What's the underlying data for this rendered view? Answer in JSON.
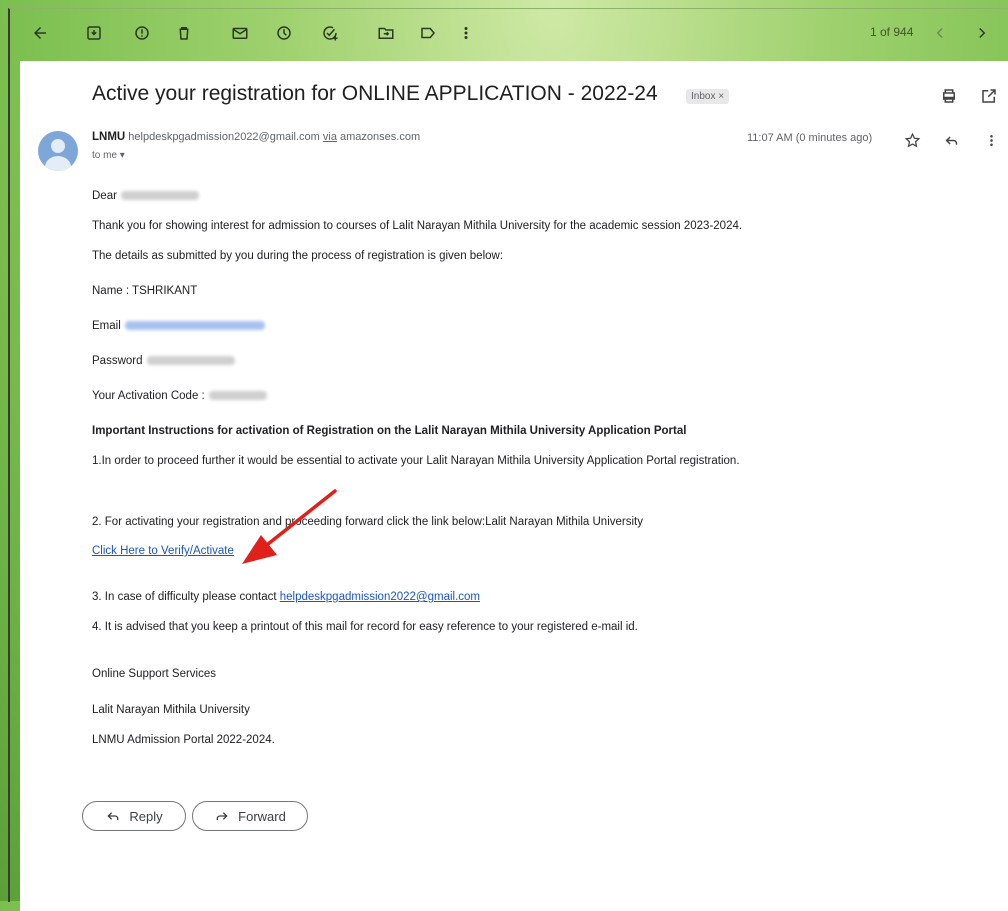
{
  "toolbar": {
    "counter": "1 of 944"
  },
  "email": {
    "subject": "Active your registration for ONLINE APPLICATION - 2022-24",
    "label_chip": "Inbox ×",
    "sender_name": "LNMU",
    "sender_email": "helpdeskpgadmission2022@gmail.com",
    "via_word": "via",
    "via_domain": "amazonses.com",
    "to_line": "to me ▾",
    "time": "11:07 AM (0 minutes ago)",
    "greeting": "Dear",
    "line_thanks": "Thank you for showing interest for admission to courses of Lalit Narayan Mithila University for the academic session 2023-2024.",
    "line_details": "The details as submitted by you during the process of registration is given below:",
    "name_line": "Name : TSHRIKANT",
    "email_label": "Email",
    "password_label": "Password",
    "activation_label": "Your Activation Code :",
    "instructions_heading": "Important Instructions for activation of Registration on the Lalit Narayan Mithila University Application Portal",
    "step1": "1.In order to proceed further it would be essential to activate your Lalit Narayan Mithila University Application Portal registration.",
    "step2": "2. For activating your registration and proceeding forward click the link below:Lalit Narayan Mithila University",
    "verify_link": "Click Here to Verify/Activate",
    "step3_prefix": "3. In case of difficulty please contact",
    "step3_email": "helpdeskpgadmission2022@gmail.com",
    "step4": "4. It is advised that you keep a printout of this mail for record for easy reference to your registered e-mail id.",
    "sig1": "Online Support Services",
    "sig2": "Lalit Narayan Mithila University",
    "sig3": "LNMU Admission Portal 2022-2024."
  },
  "actions": {
    "reply_label": "Reply",
    "forward_label": "Forward"
  },
  "colors": {
    "link": "#1a55c4",
    "annotation_arrow": "#e0211b",
    "background_green": "#7bbf4f"
  },
  "icons": {
    "toolbar": [
      "back-arrow-icon",
      "archive-icon",
      "report-spam-icon",
      "delete-icon",
      "mark-unread-icon",
      "snooze-icon",
      "add-task-icon",
      "move-to-icon",
      "label-icon",
      "more-vert-icon",
      "prev-icon",
      "next-icon"
    ],
    "header": [
      "print-icon",
      "open-new-window-icon",
      "star-icon",
      "reply-icon",
      "more-vert-icon"
    ]
  }
}
